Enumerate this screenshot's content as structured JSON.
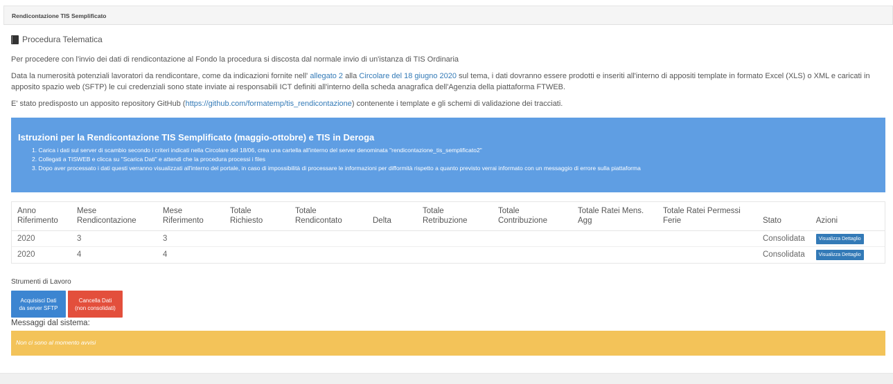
{
  "panel": {
    "title": "Rendicontazione TIS Semplificato"
  },
  "procedure": {
    "icon": "book-icon",
    "title": "Procedura Telematica"
  },
  "intro": {
    "p1": "Per procedere con l'invio dei dati di rendicontazione al Fondo la procedura si discosta dal normale invio di un'istanza di TIS Ordinaria",
    "p2_a": "Data la numerosità potenziali lavoratori da rendicontare, come da indicazioni fornite nell' ",
    "p2_link1": "allegato 2",
    "p2_b": " alla ",
    "p2_link2": "Circolare del 18 giugno 2020",
    "p2_c": " sul tema, i dati dovranno essere prodotti e inseriti all'interno di appositi template in formato Excel (XLS) o XML e caricati in apposito spazio web (SFTP) le cui credenziali sono state inviate ai responsabili ICT definiti all'interno della scheda anagrafica dell'Agenzia della piattaforma FTWEB.",
    "p3_a": "E' stato predisposto un apposito repository GitHub (",
    "p3_link": "https://github.com/formatemp/tis_rendicontazione",
    "p3_b": ") contenente i template e gli schemi di validazione dei tracciati."
  },
  "instructions": {
    "title": "Istruzioni per la Rendicontazione TIS Semplificato (maggio-ottobre) e TIS in Deroga",
    "items": [
      "1. Carica i dati sul server di scambio secondo i criteri indicati nella Circolare del 18/06, crea una cartella all'interno del server denominata \"rendicontazione_tis_semplificato2\"",
      "2. Collegati a TISWEB e clicca su \"Scarica Dati\" e attendi che la procedura processi i files",
      "3. Dopo aver processato i dati questi verranno visualizzati all'interno del portale, in caso di impossibilità di processare le informazioni per difformità rispetto a quanto previsto verrai informato con un messaggio di errore sulla piattaforma"
    ]
  },
  "table": {
    "headers": {
      "anno_1": "Anno",
      "anno_2": "Riferimento",
      "mese_rend_1": "Mese",
      "mese_rend_2": "Rendicontazione",
      "mese_rif_1": "Mese",
      "mese_rif_2": "Riferimento",
      "tot_rich_1": "Totale",
      "tot_rich_2": "Richiesto",
      "tot_rend_1": "Totale",
      "tot_rend_2": "Rendicontato",
      "delta": "Delta",
      "tot_retr_1": "Totale",
      "tot_retr_2": "Retribuzione",
      "tot_contr_1": "Totale",
      "tot_contr_2": "Contribuzione",
      "ratei_mens_1": "Totale Ratei Mens.",
      "ratei_mens_2": "Agg",
      "ratei_perm_1": "Totale Ratei Permessi",
      "ratei_perm_2": "Ferie",
      "stato": "Stato",
      "azioni": "Azioni"
    },
    "rows": [
      {
        "anno": "2020",
        "mese_rend": "3",
        "mese_rif": "3",
        "stato": "Consolidata",
        "action": "Visualizza Dettaglio"
      },
      {
        "anno": "2020",
        "mese_rend": "4",
        "mese_rif": "4",
        "stato": "Consolidata",
        "action": "Visualizza Dettaglio"
      }
    ]
  },
  "tools": {
    "label": "Strumenti di Lavoro",
    "acquire_1": "Acquisisci Dati",
    "acquire_2": "da server SFTP",
    "delete_1": "Cancella Dati",
    "delete_2": "(non consolidati)"
  },
  "messages": {
    "label": "Messaggi dal sistema:",
    "text": "Non ci sono al momento avvisi"
  },
  "colors": {
    "info": "#5f9ee3",
    "warning": "#f3c359",
    "primary": "#337ab7",
    "danger": "#e34f3c"
  }
}
